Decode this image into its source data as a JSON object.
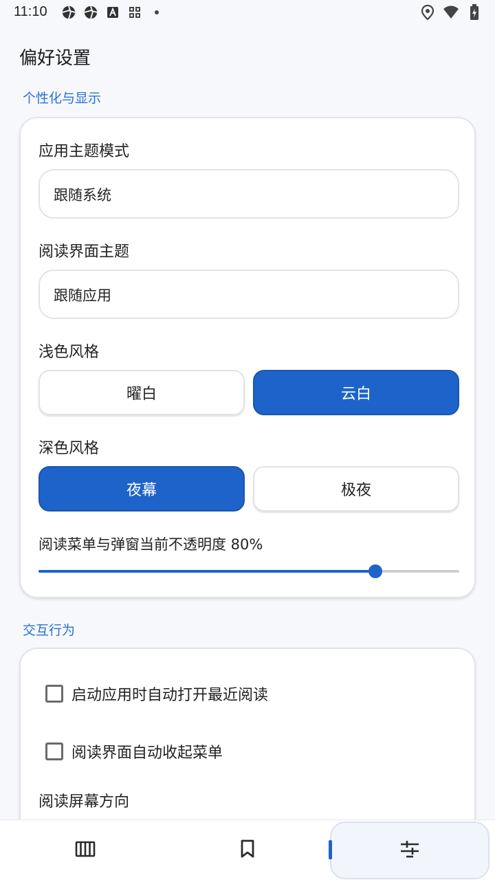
{
  "status_bar": {
    "time": "11:10"
  },
  "page": {
    "title": "偏好设置"
  },
  "sections": {
    "display": {
      "label": "个性化与显示",
      "app_theme": {
        "label": "应用主题模式",
        "value": "跟随系统"
      },
      "reader_theme": {
        "label": "阅读界面主题",
        "value": "跟随应用"
      },
      "light_style": {
        "label": "浅色风格",
        "options": [
          "曜白",
          "云白"
        ],
        "selected": "云白"
      },
      "dark_style": {
        "label": "深色风格",
        "options": [
          "夜幕",
          "极夜"
        ],
        "selected": "夜幕"
      },
      "opacity": {
        "label": "阅读菜单与弹窗当前不透明度 80%",
        "value_fraction": 0.8
      }
    },
    "interaction": {
      "label": "交互行为",
      "auto_open_recent": {
        "label": "启动应用时自动打开最近阅读",
        "checked": false
      },
      "auto_collapse_menu": {
        "label": "阅读界面自动收起菜单",
        "checked": false
      },
      "orientation": {
        "label": "阅读屏幕方向"
      }
    }
  },
  "bottom_nav": {
    "items": [
      {
        "icon": "bookshelf-icon"
      },
      {
        "icon": "bookmark-icon"
      },
      {
        "icon": "settings-sliders-icon",
        "active": true
      }
    ]
  },
  "colors": {
    "accent": "#1e63c9",
    "section_label": "#2a6fd6"
  }
}
